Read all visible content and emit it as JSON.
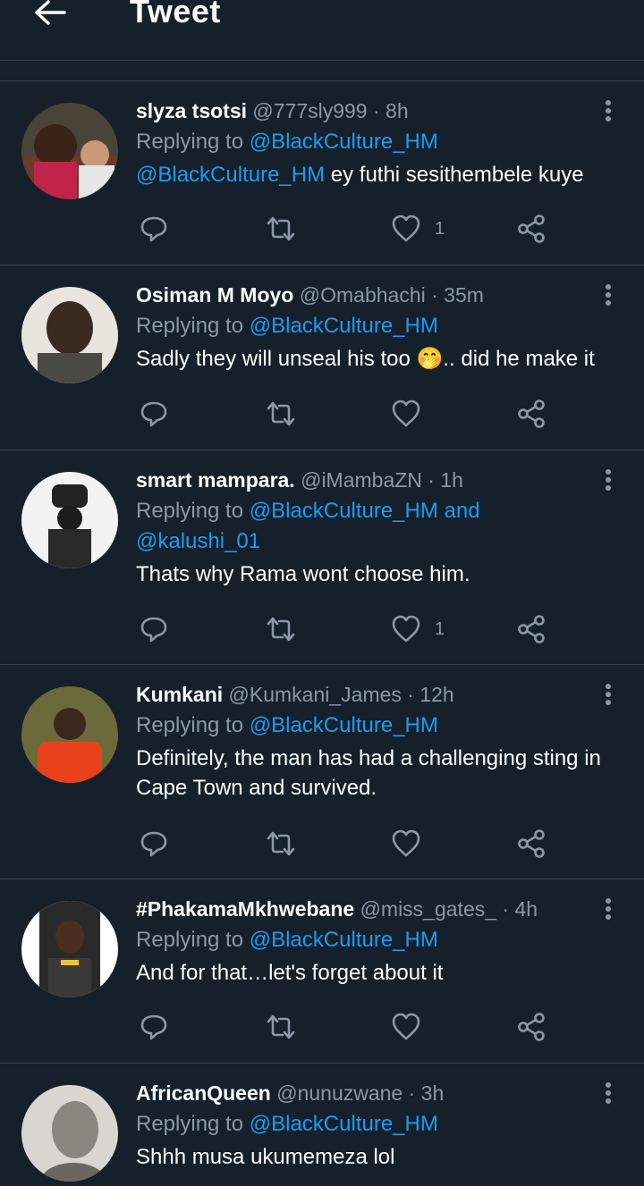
{
  "header": {
    "title": "Tweet",
    "back_icon": "arrow-left-icon"
  },
  "colors": {
    "background": "#15202b",
    "accent": "#1d9bf0",
    "muted": "#8b98a5",
    "divider": "#38444d"
  },
  "replies": [
    {
      "name": "slyza tsotsi",
      "handle": "@777sly999",
      "time": "· 8h",
      "replying_prefix": "Replying to ",
      "replying_to": "@BlackCulture_HM",
      "replying_suffix": "",
      "text_mention": "@BlackCulture_HM",
      "text": " ey futhi sesithembele kuye",
      "likes": "1"
    },
    {
      "name": "Osiman M Moyo",
      "handle": "@Omabhachi",
      "time": "· 35m",
      "replying_prefix": "Replying to ",
      "replying_to": "@BlackCulture_HM",
      "replying_suffix": "",
      "text": "Sadly they will unseal his too 🤭.. did he make it",
      "likes": ""
    },
    {
      "name": "smart mampara.",
      "handle": "@iMambaZN",
      "time": "· 1h",
      "replying_prefix": "Replying to ",
      "replying_to": "@BlackCulture_HM and",
      "replying_suffix": "@kalushi_01",
      "text": "Thats why Rama wont choose him.",
      "likes": "1"
    },
    {
      "name": "Kumkani",
      "handle": "@Kumkani_James",
      "time": "· 12h",
      "replying_prefix": "Replying to ",
      "replying_to": "@BlackCulture_HM",
      "replying_suffix": "",
      "text": "Definitely, the man has had a challenging sting in Cape Town and survived.",
      "likes": ""
    },
    {
      "name": "#PhakamaMkhwebane",
      "handle": "@miss_gates_",
      "time": "· 4h",
      "replying_prefix": "Replying to ",
      "replying_to": "@BlackCulture_HM",
      "replying_suffix": "",
      "text": "And for that…let's forget about it",
      "likes": ""
    },
    {
      "name": "AfricanQueen",
      "handle": "@nunuzwane",
      "time": "· 3h",
      "replying_prefix": "Replying to ",
      "replying_to": "@BlackCulture_HM",
      "replying_suffix": "",
      "text": "Shhh musa ukumemeza lol",
      "likes": ""
    }
  ]
}
